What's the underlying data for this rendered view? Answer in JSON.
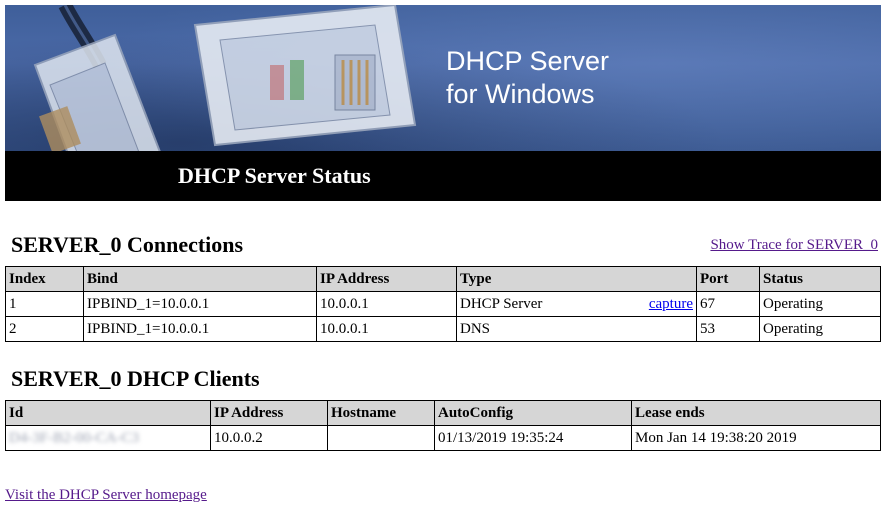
{
  "banner": {
    "heading_line1": "DHCP Server",
    "heading_line2": "for Windows",
    "status_title": "DHCP Server Status"
  },
  "connections": {
    "title": "SERVER_0 Connections",
    "trace_link": "Show Trace for SERVER_0",
    "headers": [
      "Index",
      "Bind",
      "IP Address",
      "Type",
      "Port",
      "Status"
    ],
    "rows": [
      {
        "index": "1",
        "bind": "IPBIND_1=10.0.0.1",
        "ip": "10.0.0.1",
        "type": "DHCP Server",
        "capture": "capture",
        "port": "67",
        "status": "Operating"
      },
      {
        "index": "2",
        "bind": "IPBIND_1=10.0.0.1",
        "ip": "10.0.0.1",
        "type": "DNS",
        "port": "53",
        "status": "Operating"
      }
    ]
  },
  "clients": {
    "title": "SERVER_0 DHCP Clients",
    "headers": [
      "Id",
      "IP Address",
      "Hostname",
      "AutoConfig",
      "Lease ends"
    ],
    "rows": [
      {
        "id": "D4-3F-B2-00-CA-C3",
        "ip": "10.0.0.2",
        "hostname": "",
        "autoconfig": "01/13/2019 19:35:24",
        "lease_ends": "Mon Jan 14 19:38:20 2019"
      }
    ]
  },
  "footer": {
    "home_link": "Visit the DHCP Server homepage"
  },
  "colors": {
    "banner_blue": "#4b6aa8",
    "header_gray": "#d6d6d6",
    "visited_link": "#551a8b",
    "link": "#0000ee"
  }
}
